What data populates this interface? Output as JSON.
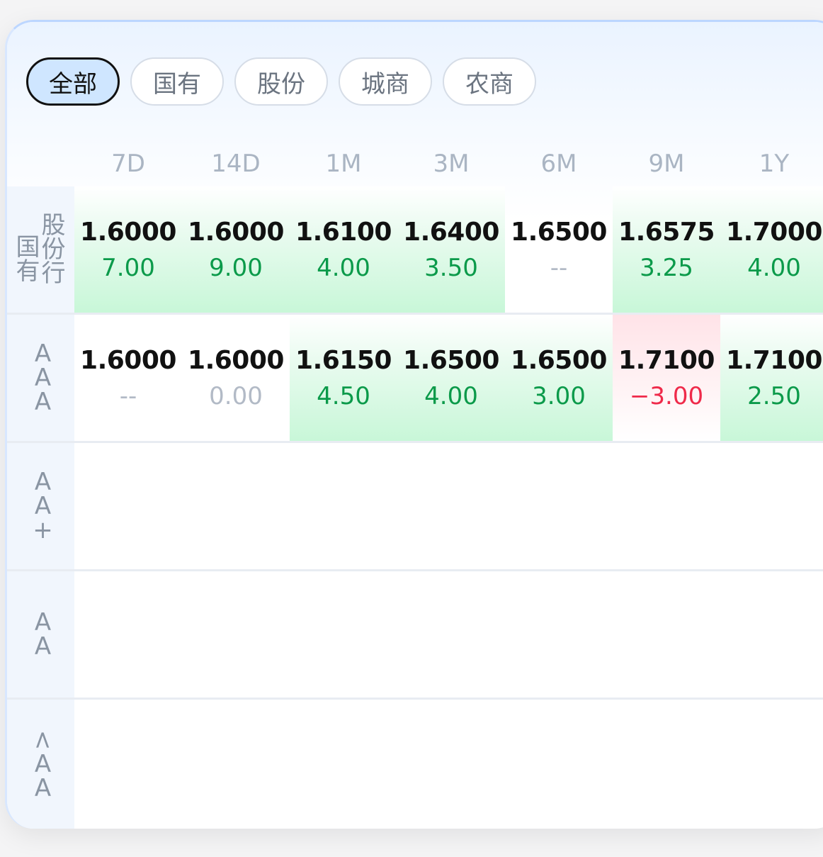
{
  "colors": {
    "up": "#0b9a4a",
    "down": "#ef2a4a",
    "flat": "#b2bac6",
    "active_tab_bg": "#cfe6ff"
  },
  "tabs": [
    {
      "label": "全部",
      "active": true
    },
    {
      "label": "国有",
      "active": false
    },
    {
      "label": "股份",
      "active": false
    },
    {
      "label": "城商",
      "active": false
    },
    {
      "label": "农商",
      "active": false
    }
  ],
  "periods": [
    "7D",
    "14D",
    "1M",
    "3M",
    "6M",
    "9M",
    "1Y"
  ],
  "rows": [
    {
      "label_a": [
        "国",
        "有"
      ],
      "label_b": [
        "股",
        "份",
        "行"
      ],
      "cells": [
        {
          "rate": "1.6000",
          "change": "7.00",
          "trend": "up"
        },
        {
          "rate": "1.6000",
          "change": "9.00",
          "trend": "up"
        },
        {
          "rate": "1.6100",
          "change": "4.00",
          "trend": "up"
        },
        {
          "rate": "1.6400",
          "change": "3.50",
          "trend": "up"
        },
        {
          "rate": "1.6500",
          "change": "--",
          "trend": "none"
        },
        {
          "rate": "1.6575",
          "change": "3.25",
          "trend": "up"
        },
        {
          "rate": "1.7000",
          "change": "4.00",
          "trend": "up"
        }
      ]
    },
    {
      "label": [
        "A",
        "A",
        "A"
      ],
      "cells": [
        {
          "rate": "1.6000",
          "change": "--",
          "trend": "none"
        },
        {
          "rate": "1.6000",
          "change": "0.00",
          "trend": "flat"
        },
        {
          "rate": "1.6150",
          "change": "4.50",
          "trend": "up"
        },
        {
          "rate": "1.6500",
          "change": "4.00",
          "trend": "up"
        },
        {
          "rate": "1.6500",
          "change": "3.00",
          "trend": "up"
        },
        {
          "rate": "1.7100",
          "change": "-3.00",
          "trend": "down"
        },
        {
          "rate": "1.7100",
          "change": "2.50",
          "trend": "up"
        }
      ]
    },
    {
      "label": [
        "A",
        "A",
        "+"
      ],
      "cells": []
    },
    {
      "label": [
        "A",
        "A"
      ],
      "cells": []
    },
    {
      "label": [
        "<",
        "A",
        "A"
      ],
      "cells": []
    }
  ]
}
